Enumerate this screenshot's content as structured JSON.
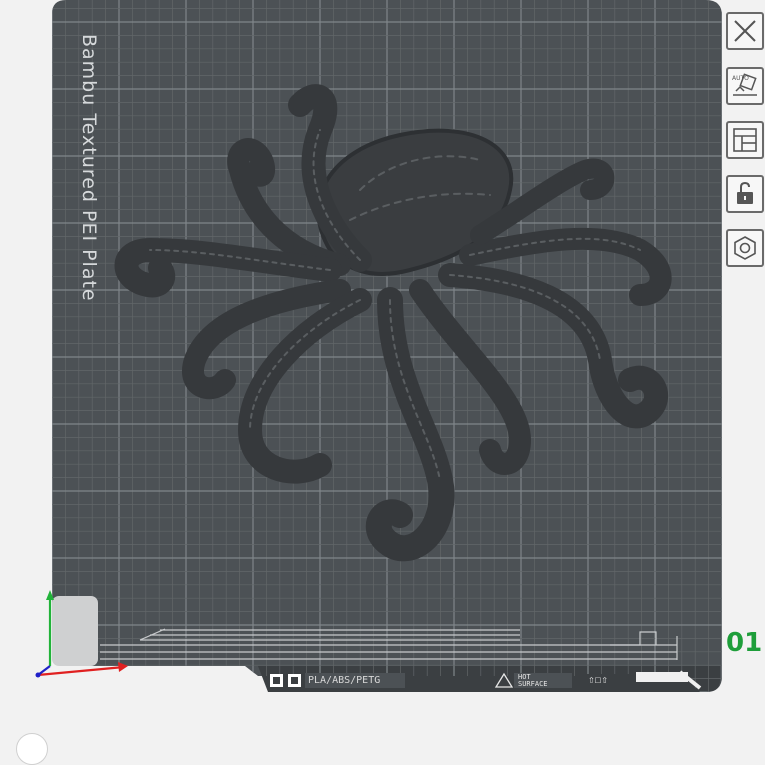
{
  "plate": {
    "label": "Bambu Textured PEI Plate",
    "number": "01",
    "material_label": "PLA/ABS/PETG",
    "warning_line1": "HOT",
    "warning_line2": "SURFACE"
  },
  "toolbar": {
    "buttons": [
      {
        "name": "remove-plate-button",
        "icon": "close-icon"
      },
      {
        "name": "auto-orient-button",
        "icon": "auto-orient-icon",
        "badge": "AUTO"
      },
      {
        "name": "arrange-button",
        "icon": "arrange-icon"
      },
      {
        "name": "lock-plate-button",
        "icon": "unlock-icon"
      },
      {
        "name": "plate-settings-button",
        "icon": "hex-nut-icon"
      }
    ]
  },
  "model": {
    "name": "octopus",
    "color": "#3a3d40"
  },
  "colors": {
    "plate": "#4c5155",
    "grid": "#6b7175",
    "axis_x": "#e02020",
    "axis_y": "#22b33a",
    "axis_z": "#2020c8",
    "plate_number": "#1e9e3a"
  }
}
